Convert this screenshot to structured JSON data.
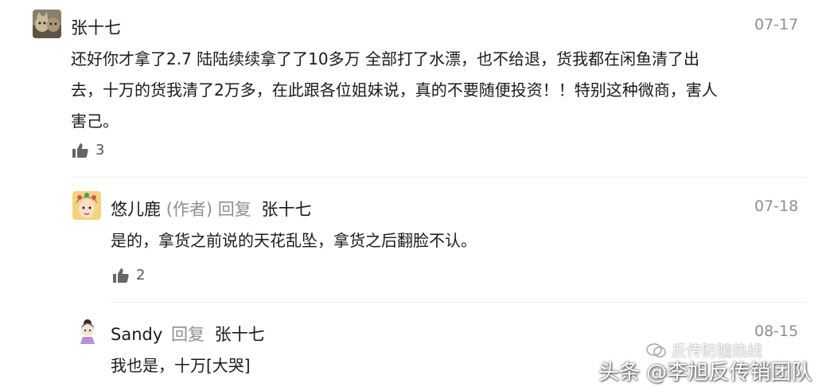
{
  "comments": [
    {
      "author": "张十七",
      "date": "07-17",
      "text_lines": [
        "还好你才拿了2.7 陆陆续续拿了了10多万 全部打了水漂，也不给退，货我都在闲鱼清了出",
        "去，十万的货我清了2万多，在此跟各位姐妹说，真的不要随便投资！！特别这种微商，害人",
        "害己。"
      ],
      "likes": "3"
    }
  ],
  "replies": [
    {
      "author": "悠儿鹿",
      "author_tag": "(作者)",
      "reply_word": "回复",
      "reply_to": "张十七",
      "date": "07-18",
      "text": "是的，拿货之前说的天花乱坠，拿货之后翻脸不认。",
      "likes": "2"
    },
    {
      "author": "Sandy",
      "reply_word": "回复",
      "reply_to": "张十七",
      "date": "08-15",
      "text": "我也是，十万[大哭]"
    }
  ],
  "watermark": {
    "small": "反传防骗热线",
    "main": "头条 @李旭反传销团队"
  },
  "icons": {
    "like": "thumbs-up-icon"
  },
  "colors": {
    "text": "#1a1a1a",
    "muted": "#8a8f99",
    "divider": "#ececec"
  }
}
